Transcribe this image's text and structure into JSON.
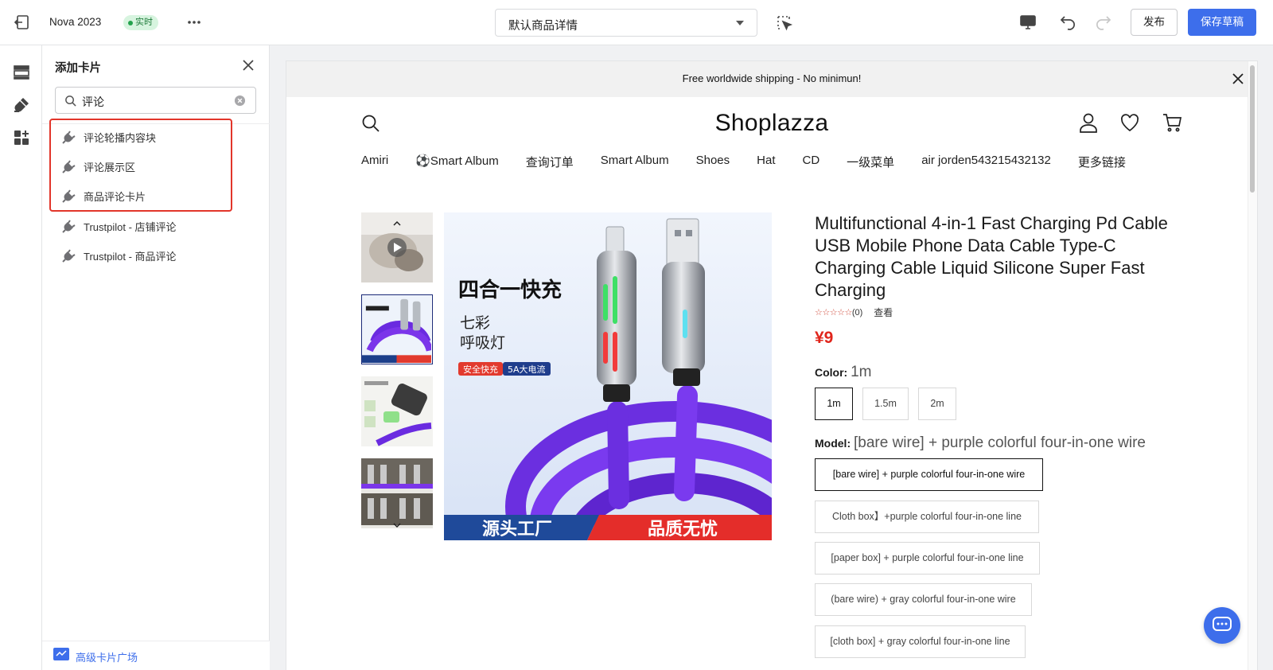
{
  "topbar": {
    "app_name": "Nova 2023",
    "live_badge": "实时",
    "template_select": "默认商品详情",
    "publish_label": "发布",
    "save_label": "保存草稿",
    "accent": "#3d6eeb"
  },
  "panel": {
    "title": "添加卡片",
    "search_value": "评论",
    "results": [
      "评论轮播内容块",
      "评论展示区",
      "商品评论卡片",
      "Trustpilot - 店铺评论",
      "Trustpilot - 商品评论"
    ],
    "footer_label": "高级卡片广场"
  },
  "store": {
    "announcement": "Free worldwide shipping - No minimun!",
    "logo": "Shoplazza",
    "nav": [
      "Amiri",
      "⚽Smart Album",
      "查询订单",
      "Smart Album",
      "Shoes",
      "Hat",
      "CD",
      "一级菜单",
      "air jorden543215432132",
      "更多链接"
    ]
  },
  "product": {
    "title": "Multifunctional 4-in-1 Fast Charging Pd Cable USB Mobile Phone Data Cable Type-C Charging Cable Liquid Silicone Super Fast Charging",
    "rating_stars": "☆☆☆☆☆",
    "rating_count": "(0)",
    "rating_view": "查看",
    "price": "¥9",
    "price_color": "#e0251b",
    "color_label": "Color:",
    "color_value": "1m",
    "colors": [
      "1m",
      "1.5m",
      "2m"
    ],
    "model_label": "Model:",
    "model_value": "[bare wire] + purple colorful four-in-one wire",
    "models": [
      "[bare wire] + purple colorful four-in-one wire",
      "Cloth box】+purple colorful four-in-one line",
      "[paper box] + purple colorful four-in-one line",
      "(bare wire) + gray colorful four-in-one wire",
      "[cloth box] + gray colorful four-in-one line"
    ],
    "image_text": {
      "headline": "四合一快充",
      "sub1": "七彩",
      "sub2": "呼吸灯",
      "tag1": "安全快充",
      "tag2": "5A大电流",
      "banner_left": "源头工厂",
      "banner_right": "品质无忧"
    }
  }
}
